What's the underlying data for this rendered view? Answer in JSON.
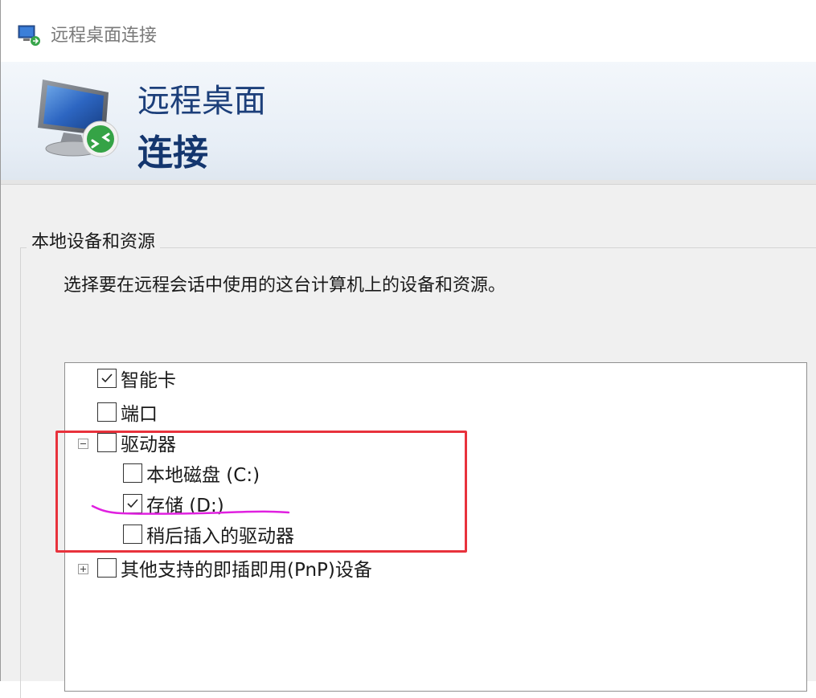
{
  "window": {
    "title": "远程桌面连接"
  },
  "banner": {
    "line1": "远程桌面",
    "line2": "连接"
  },
  "group": {
    "label": "本地设备和资源",
    "description": "选择要在远程会话中使用的这台计算机上的设备和资源。"
  },
  "tree": {
    "items": [
      {
        "label": "智能卡",
        "checked": true,
        "level": 0,
        "expander": "none"
      },
      {
        "label": "端口",
        "checked": false,
        "level": 0,
        "expander": "none"
      },
      {
        "label": "驱动器",
        "checked": false,
        "level": 0,
        "expander": "collapse"
      },
      {
        "label": "本地磁盘 (C:)",
        "checked": false,
        "level": 1,
        "expander": "none"
      },
      {
        "label": "存储 (D:)",
        "checked": true,
        "level": 1,
        "expander": "none"
      },
      {
        "label": "稍后插入的驱动器",
        "checked": false,
        "level": 1,
        "expander": "none"
      },
      {
        "label": "其他支持的即插即用(PnP)设备",
        "checked": false,
        "level": 0,
        "expander": "expand"
      }
    ]
  },
  "icons": {
    "app": "remote-desktop-icon",
    "banner": "remote-desktop-monitor-icon"
  },
  "colors": {
    "annotation_box": "#e8323c",
    "annotation_underline": "#e020e0",
    "banner_title": "#1c3f7a"
  }
}
